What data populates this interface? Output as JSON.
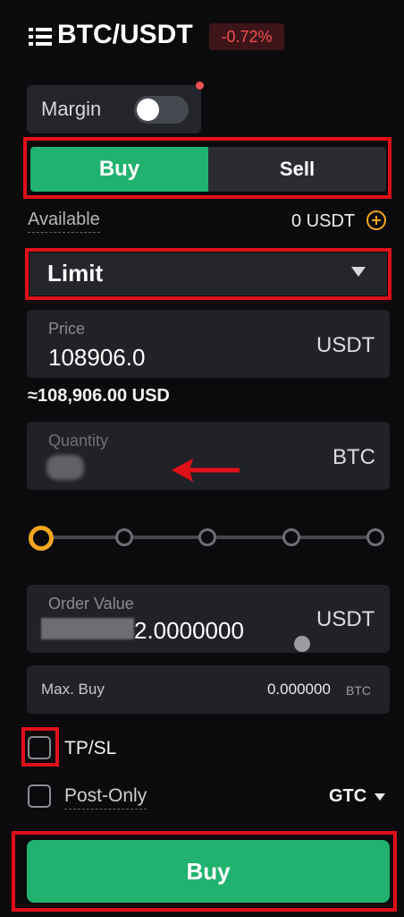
{
  "header": {
    "pair": "BTC/USDT",
    "change": "-0.72%"
  },
  "margin": {
    "label": "Margin",
    "enabled": false
  },
  "tabs": {
    "buy": "Buy",
    "sell": "Sell",
    "active": "buy"
  },
  "available": {
    "label": "Available",
    "value": "0 USDT"
  },
  "order_type": {
    "selected": "Limit"
  },
  "price": {
    "label": "Price",
    "value": "108906.0",
    "unit": "USDT",
    "usd_equiv": "≈108,906.00 USD"
  },
  "quantity": {
    "placeholder": "Quantity",
    "unit": "BTC"
  },
  "order_value": {
    "label": "Order Value",
    "value_visible": "2.0000000",
    "unit": "USDT"
  },
  "max_buy": {
    "label": "Max. Buy",
    "value": "0.000000",
    "unit": "BTC"
  },
  "tpsl": {
    "label": "TP/SL",
    "checked": false
  },
  "post_only": {
    "label": "Post-Only",
    "checked": false
  },
  "time_in_force": {
    "selected": "GTC"
  },
  "submit": {
    "label": "Buy"
  },
  "colors": {
    "buy_green": "#21b26f",
    "negative_red": "#f0504f",
    "accent_orange": "#f3a61e",
    "highlight_red": "#e0101a"
  }
}
